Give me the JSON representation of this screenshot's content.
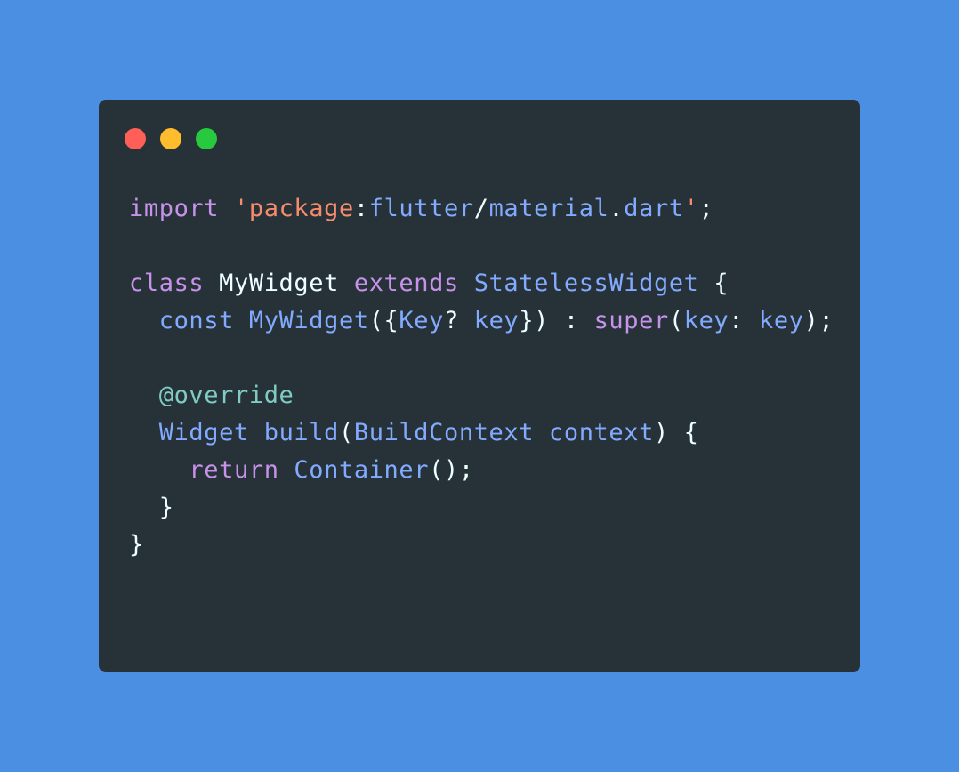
{
  "window": {
    "controls": [
      {
        "name": "close-button",
        "color": "#ff5f56"
      },
      {
        "name": "minimize-button",
        "color": "#ffbd2e"
      },
      {
        "name": "maximize-button",
        "color": "#27c93f"
      }
    ]
  },
  "colors": {
    "background": "#4a8fe2",
    "window": "#263238",
    "keyword": "#c792ea",
    "string": "#f78c6c",
    "identifier": "#82aaff",
    "plain": "#eeffff",
    "annotation": "#80cbc4"
  },
  "code": {
    "lines": [
      [
        {
          "t": "import",
          "c": "keyword"
        },
        {
          "t": " ",
          "c": "plain"
        },
        {
          "t": "'package",
          "c": "string"
        },
        {
          "t": ":",
          "c": "plain"
        },
        {
          "t": "flutter",
          "c": "identifier"
        },
        {
          "t": "/",
          "c": "plain"
        },
        {
          "t": "material",
          "c": "identifier"
        },
        {
          "t": ".",
          "c": "plain"
        },
        {
          "t": "dart",
          "c": "identifier"
        },
        {
          "t": "'",
          "c": "string"
        },
        {
          "t": ";",
          "c": "plain"
        }
      ],
      [],
      [
        {
          "t": "class",
          "c": "keyword"
        },
        {
          "t": " MyWidget ",
          "c": "plain"
        },
        {
          "t": "extends",
          "c": "keyword"
        },
        {
          "t": " ",
          "c": "plain"
        },
        {
          "t": "StatelessWidget",
          "c": "identifier"
        },
        {
          "t": " {",
          "c": "plain"
        }
      ],
      [
        {
          "t": "  ",
          "c": "plain"
        },
        {
          "t": "const",
          "c": "identifier"
        },
        {
          "t": " ",
          "c": "plain"
        },
        {
          "t": "MyWidget",
          "c": "identifier"
        },
        {
          "t": "({",
          "c": "plain"
        },
        {
          "t": "Key",
          "c": "identifier"
        },
        {
          "t": "? ",
          "c": "plain"
        },
        {
          "t": "key",
          "c": "identifier"
        },
        {
          "t": "}) : ",
          "c": "plain"
        },
        {
          "t": "super",
          "c": "keyword"
        },
        {
          "t": "(",
          "c": "plain"
        },
        {
          "t": "key",
          "c": "identifier"
        },
        {
          "t": ": ",
          "c": "plain"
        },
        {
          "t": "key",
          "c": "identifier"
        },
        {
          "t": ");",
          "c": "plain"
        }
      ],
      [],
      [
        {
          "t": "  ",
          "c": "plain"
        },
        {
          "t": "@override",
          "c": "annotation"
        }
      ],
      [
        {
          "t": "  ",
          "c": "plain"
        },
        {
          "t": "Widget",
          "c": "identifier"
        },
        {
          "t": " ",
          "c": "plain"
        },
        {
          "t": "build",
          "c": "identifier"
        },
        {
          "t": "(",
          "c": "plain"
        },
        {
          "t": "BuildContext",
          "c": "identifier"
        },
        {
          "t": " ",
          "c": "plain"
        },
        {
          "t": "context",
          "c": "identifier"
        },
        {
          "t": ") {",
          "c": "plain"
        }
      ],
      [
        {
          "t": "    ",
          "c": "plain"
        },
        {
          "t": "return",
          "c": "keyword"
        },
        {
          "t": " ",
          "c": "plain"
        },
        {
          "t": "Container",
          "c": "identifier"
        },
        {
          "t": "();",
          "c": "plain"
        }
      ],
      [
        {
          "t": "  }",
          "c": "plain"
        }
      ],
      [
        {
          "t": "}",
          "c": "plain"
        }
      ]
    ]
  }
}
